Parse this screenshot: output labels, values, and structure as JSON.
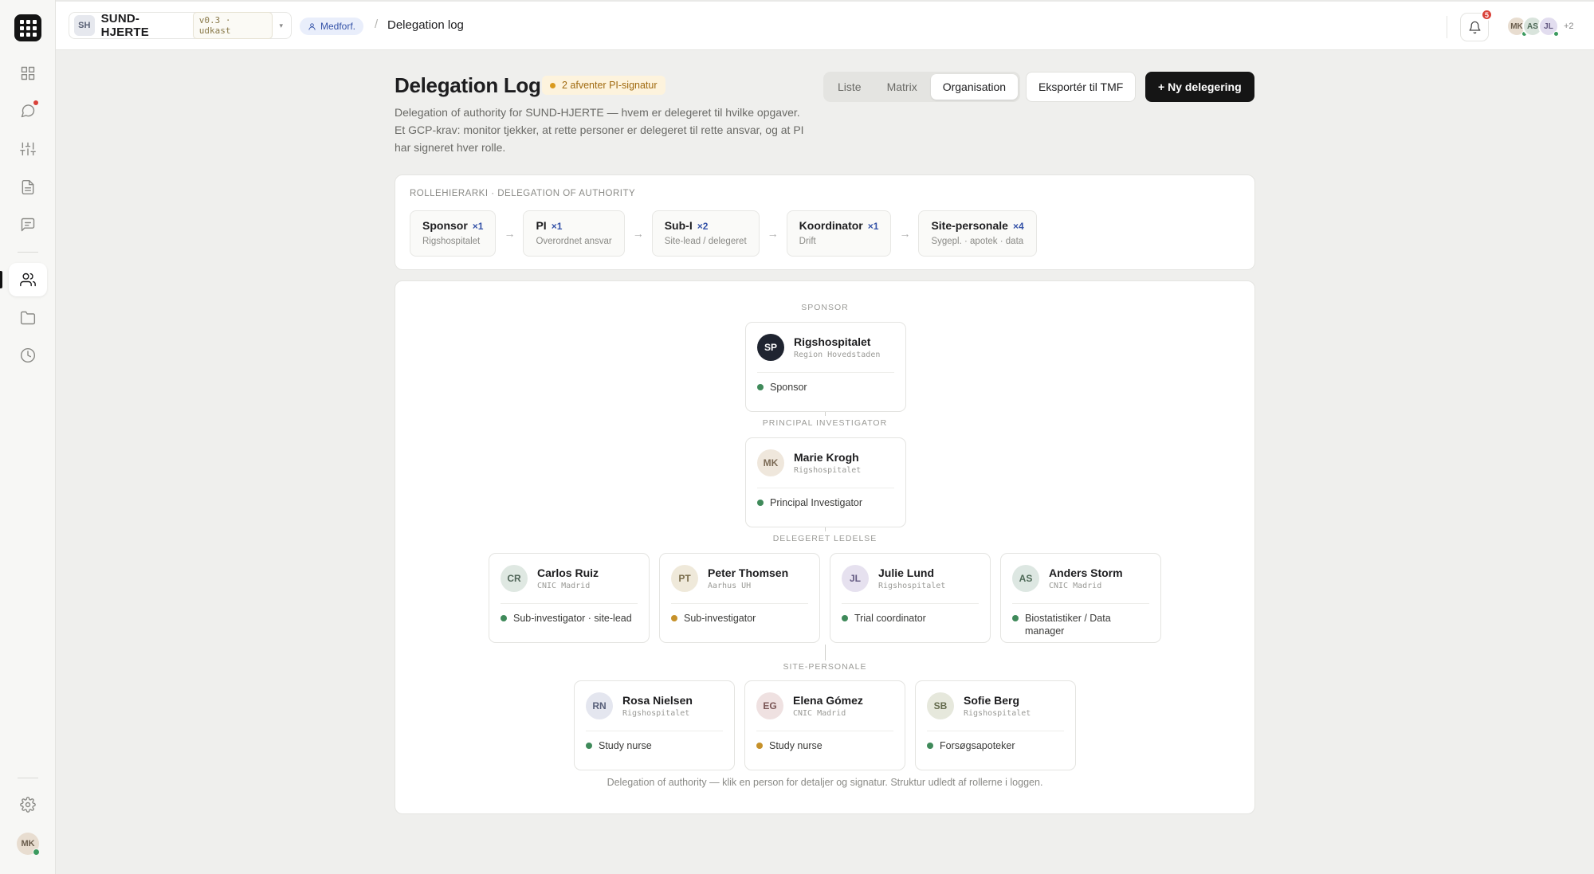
{
  "topbar": {
    "project_badge": "SH",
    "project_name": "SUND-HJERTE",
    "project_version": "v0.3 · udkast",
    "caret": "▾",
    "role_chip": "Medforf.",
    "crumb_separator": "/",
    "page": "Delegation log",
    "notifications": "5",
    "avatars": [
      {
        "initials": "MK",
        "bg": "#e8ddd0",
        "fg": "#6b5e4e"
      },
      {
        "initials": "AS",
        "bg": "#d9e4dc",
        "fg": "#4f6a58"
      },
      {
        "initials": "JL",
        "bg": "#e2ddef",
        "fg": "#645a82"
      }
    ],
    "more_avatars": "+2"
  },
  "sidebar": {
    "items": [
      "dashboard-icon",
      "chat-icon",
      "sliders-icon",
      "document-icon",
      "message-square-icon",
      "users-icon",
      "folder-icon",
      "clock-icon"
    ],
    "active": "users-icon",
    "user_initials": "MK"
  },
  "header": {
    "title": "Delegation Log",
    "pending_badge": "2  afventer PI-signatur",
    "description": "Delegation of authority for SUND-HJERTE — hvem er delegeret til hvilke opgaver. Et GCP-krav: monitor tjekker, at rette personer er delegeret til rette ansvar, og at PI har signeret hver rolle.",
    "views": [
      "Liste",
      "Matrix",
      "Organisation"
    ],
    "active_view": "Organisation",
    "export_label": "Eksportér til TMF",
    "new_label": "+  Ny delegering"
  },
  "hierarchy": {
    "label": "Rollehierarki · Delegation of authority",
    "arrow": "→",
    "roles": [
      {
        "name": "Sponsor",
        "count": "×1",
        "sub": "Rigshospitalet"
      },
      {
        "name": "PI",
        "count": "×1",
        "sub": "Overordnet ansvar"
      },
      {
        "name": "Sub-I",
        "count": "×2",
        "sub": "Site-lead / delegeret"
      },
      {
        "name": "Koordinator",
        "count": "×1",
        "sub": "Drift"
      },
      {
        "name": "Site-personale",
        "count": "×4",
        "sub": "Sygepl. · apotek · data"
      }
    ]
  },
  "org": {
    "levels": [
      "Sponsor",
      "Principal investigator",
      "Delegeret ledelse",
      "Site-personale"
    ],
    "sponsor": {
      "initials": "SP",
      "name": "Rigshospitalet",
      "org": "Region Hovedstaden",
      "role": "Sponsor",
      "status": "green"
    },
    "pi": {
      "initials": "MK",
      "name": "Marie Krogh",
      "org": "Rigshospitalet",
      "role": "Principal Investigator",
      "status": "green"
    },
    "leads": [
      {
        "initials": "CR",
        "name": "Carlos Ruiz",
        "org": "CNIC Madrid",
        "role": "Sub-investigator · site-lead",
        "status": "green"
      },
      {
        "initials": "PT",
        "name": "Peter Thomsen",
        "org": "Aarhus UH",
        "role": "Sub-investigator",
        "status": "amber"
      },
      {
        "initials": "JL",
        "name": "Julie Lund",
        "org": "Rigshospitalet",
        "role": "Trial coordinator",
        "status": "green"
      },
      {
        "initials": "AS",
        "name": "Anders Storm",
        "org": "CNIC Madrid",
        "role": "Biostatistiker / Data manager",
        "status": "green"
      }
    ],
    "staff": [
      {
        "initials": "RN",
        "name": "Rosa Nielsen",
        "org": "Rigshospitalet",
        "role": "Study nurse",
        "status": "green"
      },
      {
        "initials": "EG",
        "name": "Elena Gómez",
        "org": "CNIC Madrid",
        "role": "Study nurse",
        "status": "amber"
      },
      {
        "initials": "SB",
        "name": "Sofie Berg",
        "org": "Rigshospitalet",
        "role": "Forsøgsapoteker",
        "status": "green"
      }
    ],
    "footer": "Delegation of authority — klik en person for detaljer og signatur. Struktur udledt af rollerne i loggen."
  }
}
